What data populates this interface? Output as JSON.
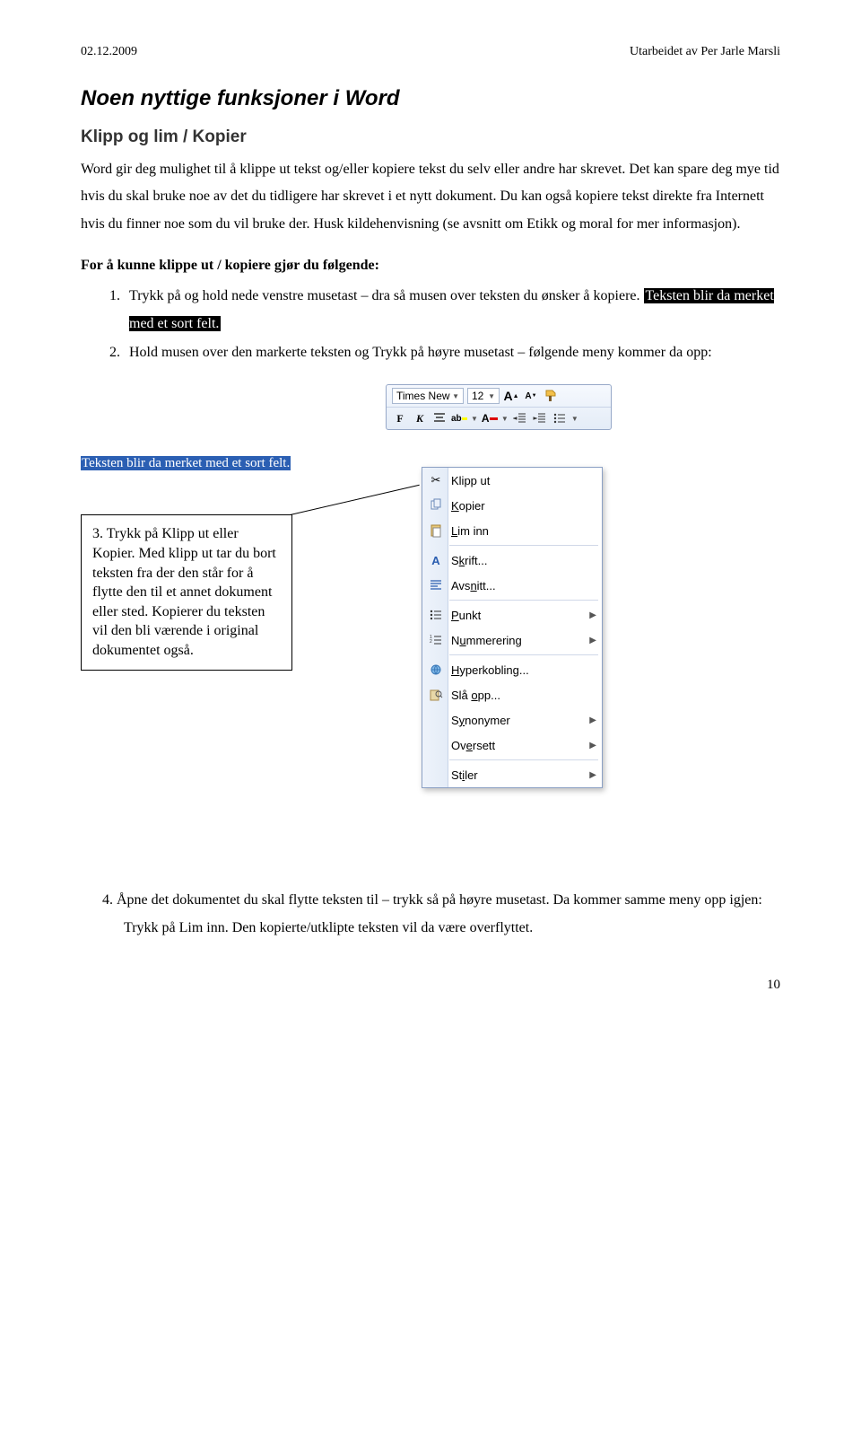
{
  "header": {
    "date": "02.12.2009",
    "author": "Utarbeidet av Per Jarle Marsli"
  },
  "title": "Noen nyttige funksjoner i Word",
  "subtitle": "Klipp og lim / Kopier",
  "para1": "Word gir deg mulighet til å klippe ut tekst og/eller kopiere tekst du selv eller andre har skrevet. Det kan spare deg mye tid hvis du skal bruke noe av det du tidligere har skrevet i et nytt dokument. Du kan også kopiere tekst direkte fra Internett hvis du finner noe som du vil bruke der. Husk kildehenvisning (se avsnitt om Etikk og moral for mer informasjon).",
  "steps_heading": "For å kunne klippe ut / kopiere gjør du følgende:",
  "step1_a": "Trykk på og hold nede venstre musetast – dra så musen over teksten du ønsker å kopiere. ",
  "step1_hl": "Teksten blir da merket med et sort felt.",
  "step2": "Hold musen over den markerte teksten og Trykk på høyre musetast – følgende meny kommer da opp:",
  "toolbar": {
    "font": "Times New",
    "size": "12",
    "bold": "F",
    "italic": "K",
    "ab": "ab"
  },
  "selected_text": "Teksten blir da merket med et sort felt.",
  "menu": {
    "cut": "Klipp ut",
    "copy": "Kopier",
    "paste": "Lim inn",
    "font": "Skrift...",
    "paragraph": "Avsnitt...",
    "bullets": "Punkt",
    "numbering": "Nummerering",
    "hyperlink": "Hyperkobling...",
    "lookup": "Slå opp...",
    "synonyms": "Synonymer",
    "translate": "Oversett",
    "styles": "Stiler"
  },
  "callout": "3. Trykk på Klipp ut eller Kopier. Med klipp ut tar du bort teksten fra der den står for å flytte den til et annet dokument eller sted. Kopierer du teksten vil den bli værende i original dokumentet også.",
  "step4": "4.   Åpne det dokumentet du skal flytte teksten til – trykk så på høyre musetast. Da kommer samme meny opp igjen: Trykk på Lim inn. Den kopierte/utklipte teksten vil da være overflyttet.",
  "page_number": "10"
}
